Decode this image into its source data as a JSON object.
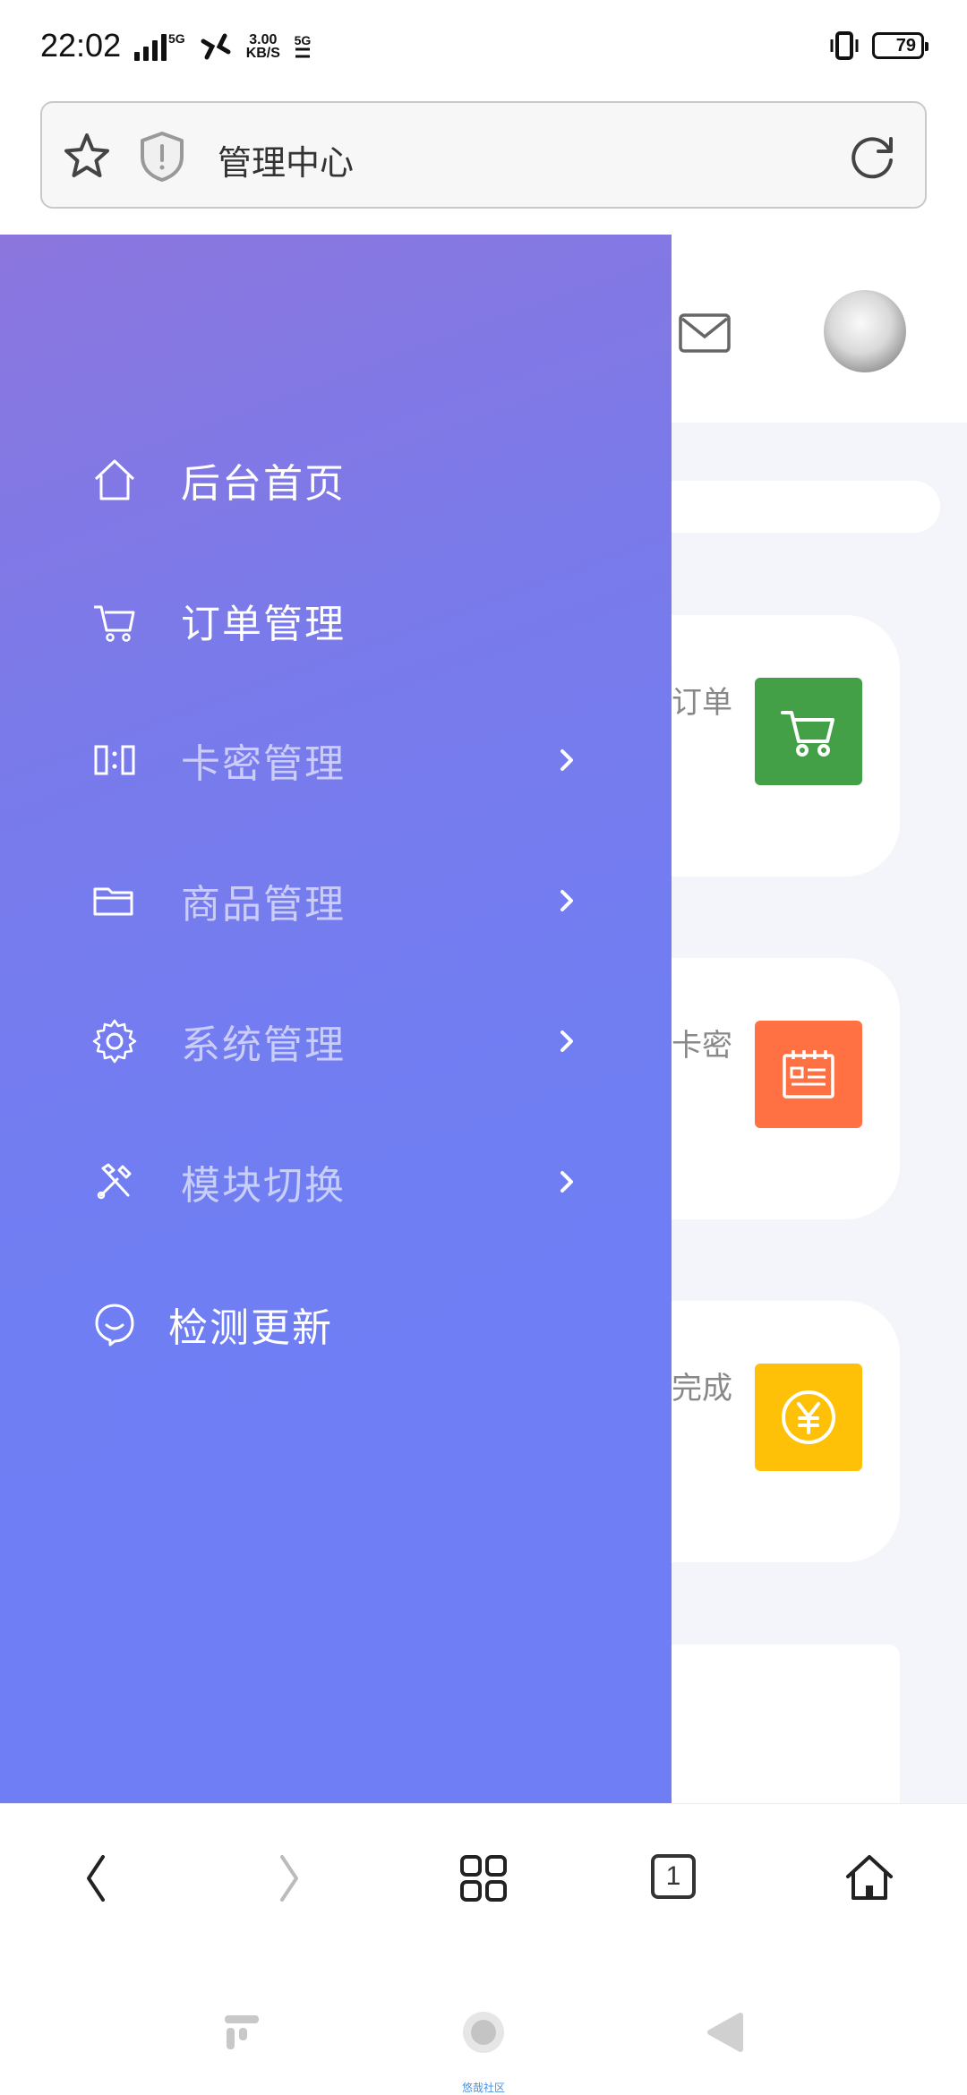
{
  "status_bar": {
    "time": "22:02",
    "network_type_1": "5G",
    "net_speed_value": "3.00",
    "net_speed_unit": "KB/S",
    "network_type_2": "5G",
    "battery_level": "79"
  },
  "browser": {
    "page_title": "管理中心"
  },
  "drawer": {
    "items": [
      {
        "label": "后台首页",
        "icon": "home-icon",
        "has_chevron": false
      },
      {
        "label": "订单管理",
        "icon": "cart-icon",
        "has_chevron": false
      },
      {
        "label": "卡密管理",
        "icon": "card-key-icon",
        "has_chevron": true
      },
      {
        "label": "商品管理",
        "icon": "folder-icon",
        "has_chevron": true
      },
      {
        "label": "系统管理",
        "icon": "gear-icon",
        "has_chevron": true
      },
      {
        "label": "模块切换",
        "icon": "tools-icon",
        "has_chevron": true
      },
      {
        "label": "检测更新",
        "icon": "smile-icon",
        "has_chevron": false
      }
    ]
  },
  "background_page": {
    "cards": [
      {
        "label_fragment": "订单",
        "icon": "cart-icon",
        "color": "#43a047"
      },
      {
        "label_fragment": "卡密",
        "icon": "notepad-icon",
        "color": "#ff7043"
      },
      {
        "label_fragment": "完成",
        "icon": "yen-icon",
        "color": "#ffc107"
      }
    ]
  },
  "browser_toolbar": {
    "tab_count": "1"
  },
  "system_nav": {
    "caption": "悠哉社区"
  },
  "colors": {
    "drawer_gradient_start": "#8c76de",
    "drawer_gradient_end": "#6f7ef5"
  }
}
